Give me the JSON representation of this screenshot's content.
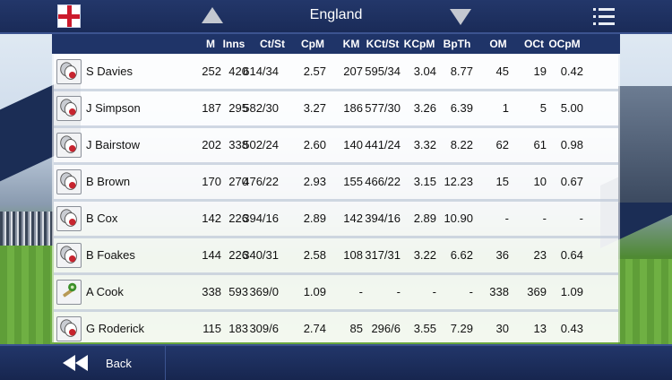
{
  "header": {
    "title": "England",
    "flag_icon": "england-flag-icon",
    "prev_icon": "triangle-up-icon",
    "next_icon": "triangle-down-icon",
    "menu_icon": "list-menu-icon"
  },
  "table": {
    "columns": [
      "M",
      "Inns",
      "Ct/St",
      "CpM",
      "KM",
      "KCt/St",
      "KCpM",
      "BpTh",
      "OM",
      "OCt",
      "OCpM"
    ],
    "rows": [
      {
        "name": "S Davies",
        "role_icon": "wicketkeeper-gloves-icon",
        "values": [
          "252",
          "420",
          "614/34",
          "2.57",
          "207",
          "595/34",
          "3.04",
          "8.77",
          "45",
          "19",
          "0.42"
        ]
      },
      {
        "name": "J Simpson",
        "role_icon": "wicketkeeper-gloves-icon",
        "values": [
          "187",
          "295",
          "582/30",
          "3.27",
          "186",
          "577/30",
          "3.26",
          "6.39",
          "1",
          "5",
          "5.00"
        ]
      },
      {
        "name": "J Bairstow",
        "role_icon": "wicketkeeper-gloves-icon",
        "values": [
          "202",
          "338",
          "502/24",
          "2.60",
          "140",
          "441/24",
          "3.32",
          "8.22",
          "62",
          "61",
          "0.98"
        ]
      },
      {
        "name": "B Brown",
        "role_icon": "wicketkeeper-gloves-icon",
        "values": [
          "170",
          "270",
          "476/22",
          "2.93",
          "155",
          "466/22",
          "3.15",
          "12.23",
          "15",
          "10",
          "0.67"
        ]
      },
      {
        "name": "B Cox",
        "role_icon": "wicketkeeper-gloves-icon",
        "values": [
          "142",
          "226",
          "394/16",
          "2.89",
          "142",
          "394/16",
          "2.89",
          "10.90",
          "-",
          "-",
          "-"
        ]
      },
      {
        "name": "B Foakes",
        "role_icon": "wicketkeeper-gloves-icon",
        "values": [
          "144",
          "226",
          "340/31",
          "2.58",
          "108",
          "317/31",
          "3.22",
          "6.62",
          "36",
          "23",
          "0.64"
        ]
      },
      {
        "name": "A Cook",
        "role_icon": "bat-and-ball-icon",
        "values": [
          "338",
          "593",
          "369/0",
          "1.09",
          "-",
          "-",
          "-",
          "-",
          "338",
          "369",
          "1.09"
        ]
      },
      {
        "name": "G Roderick",
        "role_icon": "wicketkeeper-gloves-icon",
        "values": [
          "115",
          "183",
          "309/6",
          "2.74",
          "85",
          "296/6",
          "3.55",
          "7.29",
          "30",
          "13",
          "0.43"
        ]
      }
    ]
  },
  "footer": {
    "back_label": "Back",
    "back_icon": "double-chevron-left-icon"
  }
}
